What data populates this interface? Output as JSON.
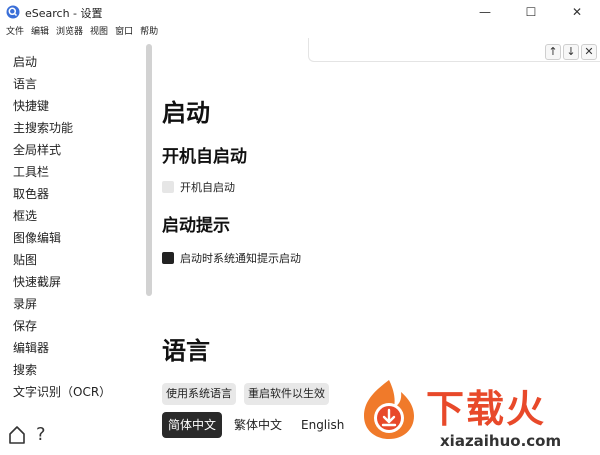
{
  "window": {
    "title": "eSearch - 设置",
    "minimize_symbol": "—",
    "maximize_symbol": "☐",
    "close_symbol": "✕"
  },
  "menu": [
    "文件",
    "编辑",
    "浏览器",
    "视图",
    "窗口",
    "帮助"
  ],
  "sidebar": {
    "items": [
      "启动",
      "语言",
      "快捷键",
      "主搜索功能",
      "全局样式",
      "工具栏",
      "取色器",
      "框选",
      "图像编辑",
      "贴图",
      "快速截屏",
      "录屏",
      "保存",
      "编辑器",
      "搜索",
      "文字识别（OCR）"
    ],
    "help_symbol": "?"
  },
  "findbar": {
    "up_symbol": "↑",
    "down_symbol": "↓",
    "close_symbol": "✕"
  },
  "content": {
    "startup_title": "启动",
    "autostart_heading": "开机自启动",
    "autostart_label": "开机自启动",
    "autostart_checked": false,
    "startup_hint_heading": "启动提示",
    "startup_hint_label": "启动时系统通知提示启动",
    "startup_hint_checked": true,
    "language_title": "语言",
    "use_system_language": "使用系统语言",
    "restart_to_apply": "重启软件以生效",
    "languages": [
      "简体中文",
      "繁体中文",
      "English"
    ],
    "selected_language": "简体中文"
  },
  "watermark": {
    "title": "下载火",
    "url": "xiazaihuo.com",
    "brand_color": "#e8492a"
  }
}
